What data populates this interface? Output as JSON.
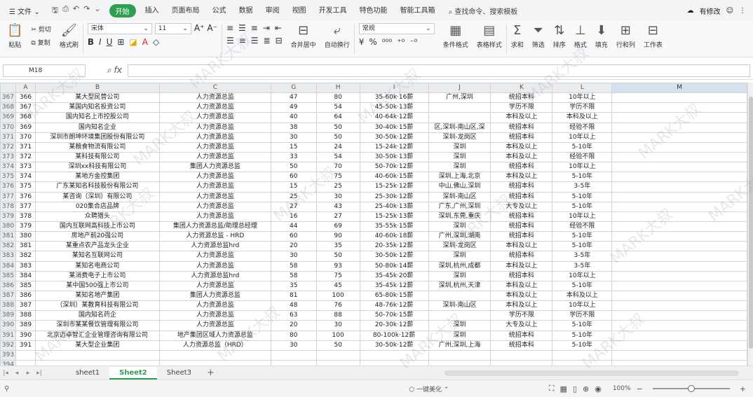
{
  "menubar": {
    "file": "文件",
    "items": [
      "开始",
      "插入",
      "页面布局",
      "公式",
      "数据",
      "审阅",
      "视图",
      "开发工具",
      "特色功能",
      "智能工具箱"
    ],
    "active_index": 0,
    "search": "查找命令、搜索模板",
    "has_changes": "有修改"
  },
  "ribbon": {
    "paste": "粘贴",
    "cut": "剪切",
    "copy": "复制",
    "format_painter": "格式刷",
    "font_name": "宋体",
    "font_size": "11",
    "merge": "合并居中",
    "wrap": "自动换行",
    "number_format": "常规",
    "cond_format": "条件格式",
    "table_style": "表格样式",
    "sum": "求和",
    "filter": "筛选",
    "sort": "排序",
    "format": "格式",
    "fill": "填充",
    "rowcol": "行和列",
    "sheet": "工作表"
  },
  "formula_bar": {
    "cell_ref": "M18",
    "fx": "fx",
    "value": ""
  },
  "grid": {
    "col_headers": [
      "",
      "A",
      "B",
      "C",
      "G",
      "H",
      "I",
      "J",
      "K",
      "L",
      "M"
    ],
    "selected_col": "M",
    "rows": [
      [
        "367",
        "366",
        "某大型民营公司",
        "人力资源总监",
        "47",
        "80",
        "35-60k·16薪",
        "广州,深圳",
        "统招本科",
        "10年以上"
      ],
      [
        "368",
        "367",
        "某国内知名投资公司",
        "人力资源总监",
        "49",
        "54",
        "45-50k·13薪",
        "",
        "学历不限",
        "学历不限"
      ],
      [
        "369",
        "368",
        "国内知名上市控股公司",
        "人力资源总监",
        "40",
        "64",
        "40-64k·12薪",
        "",
        "本科及以上",
        "本科及以上"
      ],
      [
        "370",
        "369",
        "国内知名企业",
        "人力资源总监",
        "38",
        "50",
        "30-40k·15薪",
        "区,深圳-南山区,深",
        "统招本科",
        "经验不限"
      ],
      [
        "371",
        "370",
        "深圳市朗坤环境集团股份有限公司",
        "人力资源总监",
        "30",
        "50",
        "30-50k·12薪",
        "深圳-龙岗区",
        "统招本科",
        "10年以上"
      ],
      [
        "372",
        "371",
        "某粮食物流有限公司",
        "人力资源总监",
        "15",
        "24",
        "15-24k·12薪",
        "深圳",
        "本科及以上",
        "5-10年"
      ],
      [
        "373",
        "372",
        "某科技有限公司",
        "人力资源总监",
        "33",
        "54",
        "30-50k·13薪",
        "深圳",
        "本科及以上",
        "经验不限"
      ],
      [
        "374",
        "373",
        "深圳xx科技有限公司",
        "集团人力资源总监",
        "50",
        "70",
        "50-70k·12薪",
        "深圳",
        "统招本科",
        "10年以上"
      ],
      [
        "375",
        "374",
        "某地方金控集团",
        "人力资源总监",
        "60",
        "75",
        "40-60k·15薪",
        "深圳,上海,北京",
        "本科及以上",
        "5-10年"
      ],
      [
        "376",
        "375",
        "广东某知名科技股份有限公司",
        "人力资源总监",
        "15",
        "25",
        "15-25k·12薪",
        "中山,佛山,深圳",
        "统招本科",
        "3-5年"
      ],
      [
        "377",
        "376",
        "某咨询（深圳）有限公司",
        "人力资源总监",
        "25",
        "30",
        "25-30k·12薪",
        "深圳-南山区",
        "统招本科",
        "5-10年"
      ],
      [
        "378",
        "377",
        "020集合店品牌",
        "人力资源总监",
        "27",
        "43",
        "25-40k·13薪",
        "广东,广州,深圳",
        "大专及以上",
        "5-10年"
      ],
      [
        "379",
        "378",
        "众聘猎头",
        "人力资源总监",
        "16",
        "27",
        "15-25k·13薪",
        "深圳,东莞,重庆",
        "统招本科",
        "10年以上"
      ],
      [
        "380",
        "379",
        "国内互联网高科技上市公司",
        "集团人力资源总监/助理总经理",
        "44",
        "69",
        "35-55k·15薪",
        "深圳",
        "统招本科",
        "经验不限"
      ],
      [
        "381",
        "380",
        "房地产前20强公司",
        "人力资源总监 - HRD",
        "60",
        "90",
        "40-60k·18薪",
        "广州,深圳,湖南",
        "统招本科",
        "5-10年"
      ],
      [
        "382",
        "381",
        "某重点农产品龙头企业",
        "人力资源总监hrd",
        "20",
        "35",
        "20-35k·12薪",
        "深圳-龙岗区",
        "本科及以上",
        "5-10年"
      ],
      [
        "383",
        "382",
        "某知名互联网公司",
        "人力资源总监",
        "30",
        "50",
        "30-50k·12薪",
        "深圳",
        "统招本科",
        "3-5年"
      ],
      [
        "384",
        "383",
        "某知名电商公司",
        "人力资源总监",
        "58",
        "93",
        "50-80k·14薪",
        "深圳,杭州,成都",
        "本科及以上",
        "3-5年"
      ],
      [
        "385",
        "384",
        "某消费电子上市公司",
        "人力资源总监hrd",
        "58",
        "75",
        "35-45k·20薪",
        "深圳",
        "统招本科",
        "10年以上"
      ],
      [
        "386",
        "385",
        "某中国500强上市公司",
        "人力资源总监",
        "35",
        "45",
        "35-45k·12薪",
        "深圳,杭州,天津",
        "本科及以上",
        "5-10年"
      ],
      [
        "387",
        "386",
        "某知名地产集团",
        "集团人力资源总监",
        "81",
        "100",
        "65-80k·15薪",
        "",
        "本科及以上",
        "本科及以上"
      ],
      [
        "388",
        "387",
        "（深圳）某教育科技有限公司",
        "人力资源总监",
        "48",
        "76",
        "48-76k·12薪",
        "深圳-南山区",
        "本科及以上",
        "10年以上"
      ],
      [
        "389",
        "388",
        "国内知名药企",
        "人力资源总监",
        "63",
        "88",
        "50-70k·15薪",
        "",
        "学历不限",
        "学历不限"
      ],
      [
        "390",
        "389",
        "深圳市某某餐饮管理有限公司",
        "人力资源总监",
        "20",
        "30",
        "20-30k·12薪",
        "深圳",
        "大专及以上",
        "5-10年"
      ],
      [
        "391",
        "390",
        "北京迈卓智汇企业管理咨询有限公司",
        "地产集团区域人力资源总监",
        "80",
        "100",
        "80-100k·12薪",
        "深圳",
        "统招本科",
        "5-10年"
      ],
      [
        "392",
        "391",
        "某大型企业集团",
        "人力资源总监（HRD）",
        "30",
        "50",
        "30-50k·12薪",
        "广州,深圳,上海",
        "统招本科",
        "5-10年"
      ],
      [
        "393",
        "",
        "",
        "",
        "",
        "",
        "",
        "",
        "",
        ""
      ],
      [
        "394",
        "",
        "",
        "",
        "",
        "",
        "",
        "",
        "",
        ""
      ]
    ]
  },
  "sheet_tabs": {
    "tabs": [
      "sheet1",
      "Sheet2",
      "Sheet3"
    ],
    "active_index": 1
  },
  "status_bar": {
    "center": "一键美化",
    "zoom": "100%"
  },
  "watermark": "MARK大叔",
  "colors": {
    "accent": "#2e9e4f"
  }
}
